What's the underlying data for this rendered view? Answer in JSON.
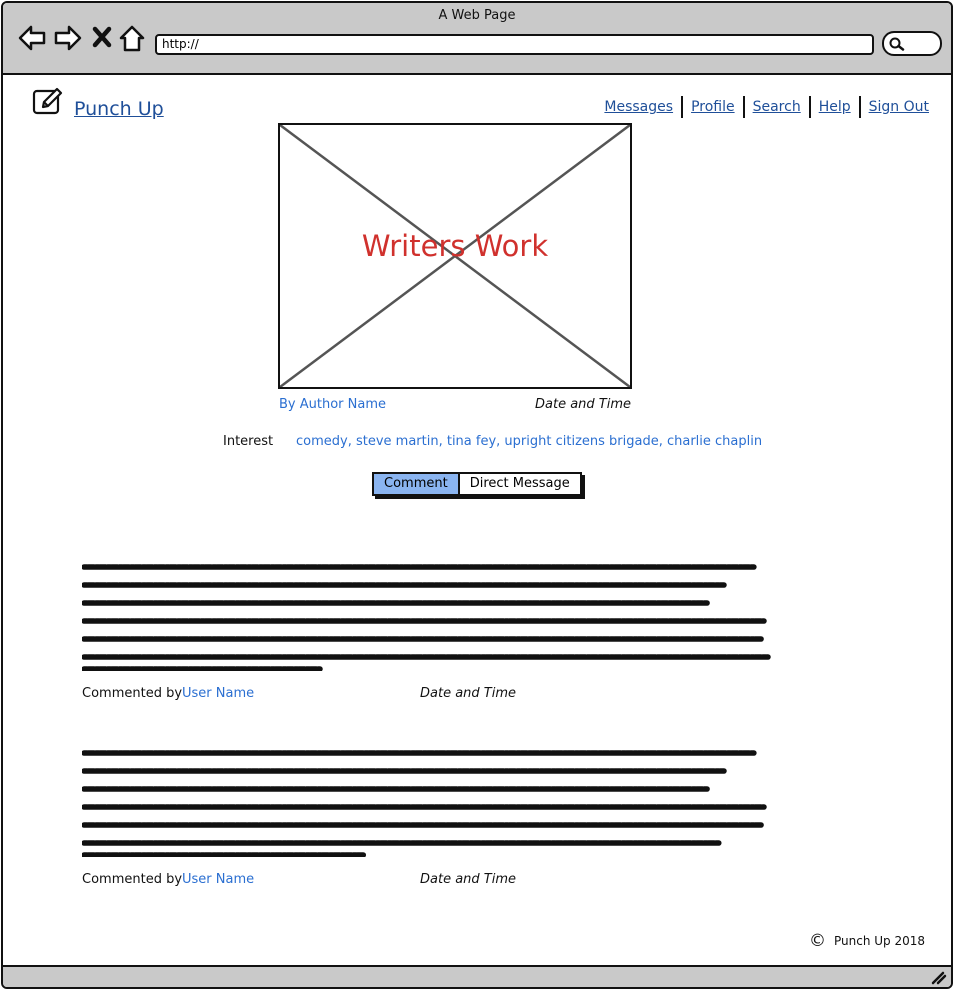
{
  "browser": {
    "window_title": "A Web Page",
    "url": "http://"
  },
  "site": {
    "title": "Punch Up",
    "nav": [
      "Messages",
      "Profile",
      "Search",
      "Help",
      "Sign Out"
    ]
  },
  "post": {
    "image_label": "Writers Work",
    "author": "By Author Name",
    "date": "Date and Time",
    "interest_label": "Interest",
    "interest_tags": "comedy, steve martin, tina fey, upright citizens brigade, charlie chaplin"
  },
  "actions": {
    "comment": "Comment",
    "direct_message": "Direct Message"
  },
  "comments": [
    {
      "prefix": "Commented by",
      "user": "User Name",
      "date": "Date and Time"
    },
    {
      "prefix": "Commented by",
      "user": "User Name",
      "date": "Date and Time"
    }
  ],
  "footer": {
    "copyright_symbol": "©",
    "text": "Punch Up 2018"
  },
  "colors": {
    "link": "#1f4f99",
    "accent_link": "#2b6fd1",
    "image_label": "#d0312d",
    "active_button": "#8ab4f0",
    "chrome": "#c9c9c9"
  }
}
